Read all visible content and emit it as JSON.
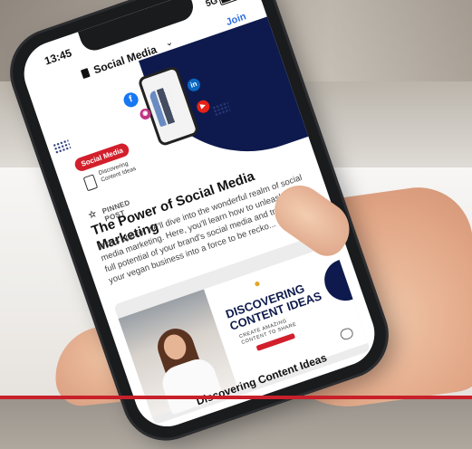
{
  "status_bar": {
    "time": "13:45",
    "network": "5G"
  },
  "nav": {
    "title": "Social Media",
    "chevron_icon": "chevron-down-icon",
    "join_label": "Join",
    "back_icon": "back-arrow-icon"
  },
  "hero": {
    "badge": "Social Media",
    "badge_sub_line1": "Discovering",
    "badge_sub_line2": "Content Ideas",
    "social_icons": [
      "facebook-icon",
      "instagram-icon",
      "linkedin-icon",
      "youtube-icon"
    ]
  },
  "post": {
    "pinned_label": "PINNED POST",
    "title": "The Power of Social Media Marketing",
    "body": "In this space, we'll dive into the wonderful realm of social media marketing. Here, you'll learn how to unleash the full potential of your brand's social media and transform your vegan business into a force to be recko..."
  },
  "card": {
    "graphic_title_line1": "DISCOVERING",
    "graphic_title_line2": "CONTENT IDEAS",
    "graphic_sub_line1": "CREATE AMAZING",
    "graphic_sub_line2": "CONTENT TO SHARE",
    "caption": "Discovering Content Ideas"
  },
  "colors": {
    "accent_red": "#d21f2b",
    "navy": "#0e1a4d",
    "link_blue": "#2f6fe0"
  }
}
